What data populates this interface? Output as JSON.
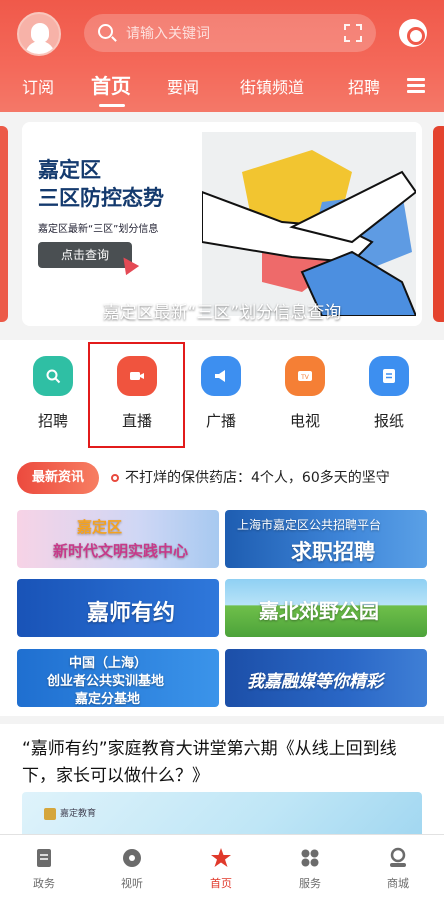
{
  "header": {
    "search_placeholder": "请输入关键词",
    "tabs": [
      {
        "label": "订阅"
      },
      {
        "label": "首页"
      },
      {
        "label": "要闻"
      },
      {
        "label": "街镇频道"
      },
      {
        "label": "招聘"
      }
    ],
    "active_tab": "首页"
  },
  "banner": {
    "title_line1": "嘉定区",
    "title_line2": "三区防控态势",
    "subtitle": "嘉定区最新“三区”划分信息",
    "button_label": "点击查询",
    "caption": "嘉定区最新“三区”划分信息查询"
  },
  "quick_icons": [
    {
      "label": "招聘",
      "icon": "search-person-icon",
      "color": "#2fbfa4"
    },
    {
      "label": "直播",
      "icon": "video-camera-icon",
      "color": "#f0543e"
    },
    {
      "label": "广播",
      "icon": "megaphone-icon",
      "color": "#3d8ff0"
    },
    {
      "label": "电视",
      "icon": "tv-icon",
      "color": "#f57f35"
    },
    {
      "label": "报纸",
      "icon": "newspaper-icon",
      "color": "#3d8ff0"
    }
  ],
  "ticker": {
    "badge": "最新资讯",
    "text": "不打烊的保供药店：4个人，60多天的坚守"
  },
  "tiles": [
    {
      "title": "嘉定区",
      "subtitle": "新时代文明实践中心"
    },
    {
      "title": "求职招聘",
      "subtitle": "上海市嘉定区公共招聘平台"
    },
    {
      "title": "嘉师有约"
    },
    {
      "title": "嘉北郊野公园"
    },
    {
      "title": "中国（上海）",
      "subtitle": "创业者公共实训基地",
      "extra": "嘉定分基地"
    },
    {
      "title": "我嘉融媒等你精彩"
    }
  ],
  "article": {
    "title": "“嘉师有约”家庭教育大讲堂第六期《从线上回到线下，家长可以做什么？》",
    "thumb_logo": "嘉定教育"
  },
  "bottom_nav": [
    {
      "label": "政务",
      "icon": "document-icon"
    },
    {
      "label": "视听",
      "icon": "disc-icon"
    },
    {
      "label": "首页",
      "icon": "home-logo-icon"
    },
    {
      "label": "服务",
      "icon": "grid-icon"
    },
    {
      "label": "商城",
      "icon": "user-circle-icon"
    }
  ],
  "colors": {
    "brand_red": "#f0594a",
    "active_nav": "#e0392b",
    "highlight_box": "#e21b1b"
  }
}
